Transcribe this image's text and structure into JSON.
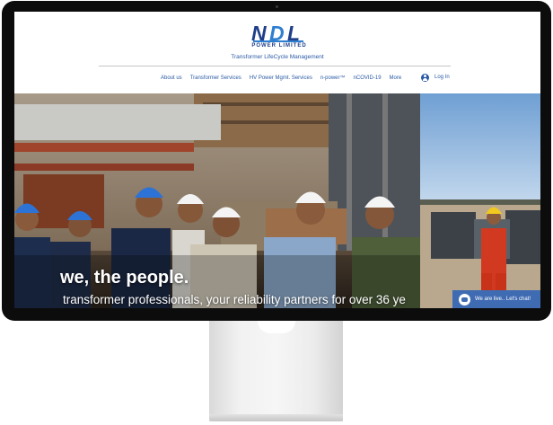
{
  "brand": {
    "logo_text": "NDL",
    "logo_subtext": "POWER LIMITED",
    "tagline": "Transformer LifeCycle Management",
    "color": "#1f3f8a"
  },
  "nav": {
    "items": [
      {
        "label": "About us"
      },
      {
        "label": "Transformer Services"
      },
      {
        "label": "HV Power Mgmt. Services"
      },
      {
        "label": "n-power™"
      },
      {
        "label": "nCOVID-19"
      },
      {
        "label": "More"
      }
    ],
    "login_label": "Log In",
    "login_icon": "user-avatar-icon"
  },
  "hero": {
    "heading": "we, the people.",
    "subheading": "transformer professionals, your reliability partners for over 36 ye"
  },
  "chat": {
    "label": "We are live.. Let's chat!",
    "icon": "chat-bubble-icon",
    "color": "#3f6bb3"
  },
  "accent_color": "#2a5aa6"
}
